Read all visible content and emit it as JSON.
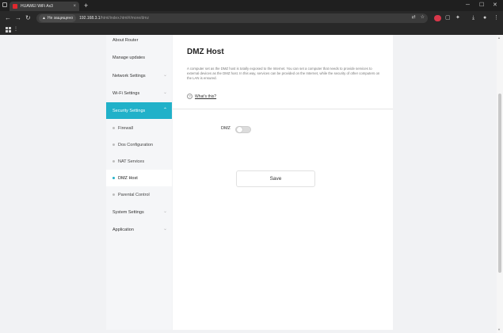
{
  "browser": {
    "tab_title": "HUAWEI WiFi Ax3",
    "tab_close": "×",
    "new_tab": "+",
    "insecure_label": "Не защищено",
    "url_host": "192.168.3.1",
    "url_path": "/html/index.html#/more/dmz",
    "window_minimize": "─",
    "window_maximize": "☐",
    "window_close": "✕",
    "back": "←",
    "forward": "→",
    "reload": "↻"
  },
  "sidebar": {
    "items": [
      {
        "label": "About Router"
      },
      {
        "label": "Manage updates"
      },
      {
        "label": "Network Settings"
      },
      {
        "label": "Wi-Fi Settings"
      },
      {
        "label": "Security Settings"
      }
    ],
    "security_sub": [
      {
        "label": "Firewall"
      },
      {
        "label": "Dos Configuration"
      },
      {
        "label": "NAT Services"
      },
      {
        "label": "DMZ Host"
      },
      {
        "label": "Parental Control"
      }
    ],
    "bottom_items": [
      {
        "label": "System Settings"
      },
      {
        "label": "Application"
      }
    ]
  },
  "main": {
    "title": "DMZ Host",
    "description": "A computer set as the DMZ host is totally exposed to the Internet. You can set a computer that needs to provide services to external devices as the DMZ host. In this way, services can be provided on the Internet, while the security of other computers on the LAN is ensured.",
    "help_icon_glyph": "?",
    "whats_this": "What's this?",
    "dmz_label": "DMZ",
    "dmz_enabled": false,
    "save_label": "Save"
  },
  "icons": {
    "chevron": "chevron-down-icon",
    "help": "help-circle-icon"
  },
  "colors": {
    "accent": "#21b1c9",
    "chrome_dark": "#282828"
  }
}
